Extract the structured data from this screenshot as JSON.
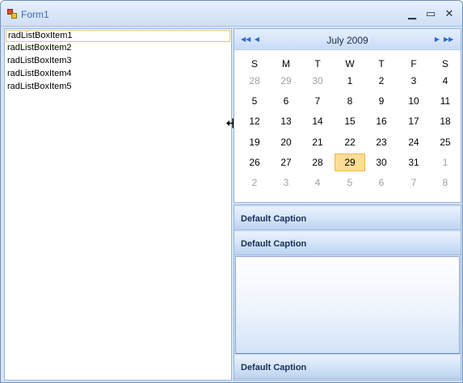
{
  "window": {
    "title": "Form1"
  },
  "title_controls": {
    "minimize": "▁",
    "maximize": "▭",
    "close": "✕"
  },
  "listbox": {
    "items": [
      "radListBoxItem1",
      "radListBoxItem2",
      "radListBoxItem3",
      "radListBoxItem4",
      "radListBoxItem5"
    ],
    "selected_index": 0
  },
  "calendar": {
    "title": "July 2009",
    "nav": {
      "fast_prev": "◀◀",
      "prev": "◀",
      "next": "▶",
      "fast_next": "▶▶"
    },
    "weekdays": [
      "S",
      "M",
      "T",
      "W",
      "T",
      "F",
      "S"
    ],
    "weeks": [
      [
        {
          "d": "28",
          "o": true
        },
        {
          "d": "29",
          "o": true
        },
        {
          "d": "30",
          "o": true
        },
        {
          "d": "1"
        },
        {
          "d": "2"
        },
        {
          "d": "3"
        },
        {
          "d": "4"
        }
      ],
      [
        {
          "d": "5"
        },
        {
          "d": "6"
        },
        {
          "d": "7"
        },
        {
          "d": "8"
        },
        {
          "d": "9"
        },
        {
          "d": "10"
        },
        {
          "d": "11"
        }
      ],
      [
        {
          "d": "12"
        },
        {
          "d": "13"
        },
        {
          "d": "14"
        },
        {
          "d": "15"
        },
        {
          "d": "16"
        },
        {
          "d": "17"
        },
        {
          "d": "18"
        }
      ],
      [
        {
          "d": "19"
        },
        {
          "d": "20"
        },
        {
          "d": "21"
        },
        {
          "d": "22"
        },
        {
          "d": "23"
        },
        {
          "d": "24"
        },
        {
          "d": "25"
        }
      ],
      [
        {
          "d": "26"
        },
        {
          "d": "27"
        },
        {
          "d": "28"
        },
        {
          "d": "29",
          "today": true
        },
        {
          "d": "30"
        },
        {
          "d": "31"
        },
        {
          "d": "1",
          "o": true
        }
      ],
      [
        {
          "d": "2",
          "o": true
        },
        {
          "d": "3",
          "o": true
        },
        {
          "d": "4",
          "o": true
        },
        {
          "d": "5",
          "o": true
        },
        {
          "d": "6",
          "o": true
        },
        {
          "d": "7",
          "o": true
        },
        {
          "d": "8",
          "o": true
        }
      ]
    ]
  },
  "panelbar": {
    "captions": [
      "Default Caption",
      "Default Caption",
      "Default Caption"
    ]
  },
  "colors": {
    "accent": "#98b5d9",
    "today": "#fddd96",
    "caption_text": "#15305a"
  }
}
